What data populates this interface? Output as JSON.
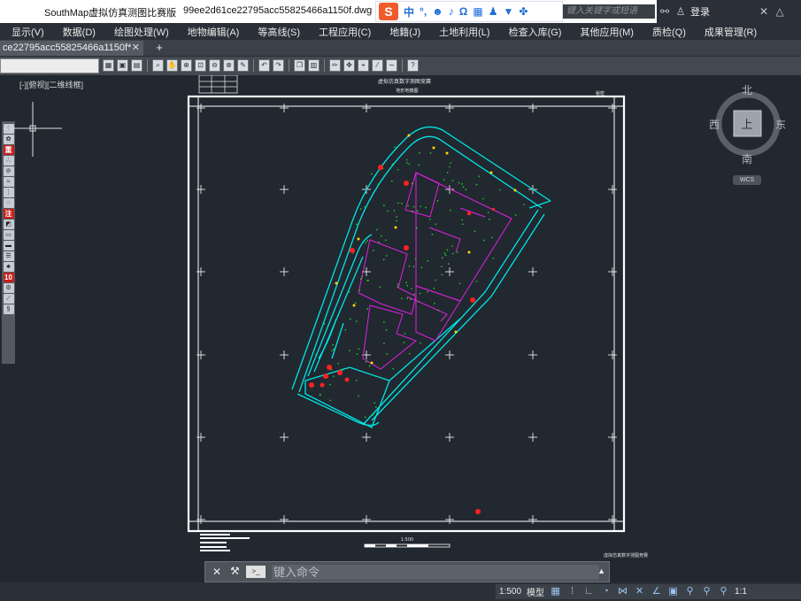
{
  "window": {
    "title": "SouthMap虚拟仿真测图比赛版",
    "filename": "99ee2d61ce22795acc55825466a1150f.dwg",
    "search_placeholder": "键入关键字或短语",
    "login_label": "登录"
  },
  "ime": {
    "mode": "中",
    "logo": "S"
  },
  "menu": [
    "显示(V)",
    "数据(D)",
    "绘图处理(W)",
    "地物编辑(A)",
    "等高线(S)",
    "工程应用(C)",
    "地籍(J)",
    "土地利用(L)",
    "检查入库(G)",
    "其他应用(M)",
    "质检(Q)",
    "成果管理(R)"
  ],
  "tabs": [
    {
      "label": "ce22795acc55825466a1150f*"
    }
  ],
  "viewport": {
    "label": "[-][俯视][二维线框]"
  },
  "left_tools": [
    "重",
    "注",
    "10"
  ],
  "drawing": {
    "top_title": "虚拟仿真数字测图竞赛",
    "top_subtitle": "地形地籍图",
    "corner_label": "秘密",
    "scale_label": "1:500",
    "bottom_label": "虚拟仿真数字测图竞赛"
  },
  "compass": {
    "north": "北",
    "south": "南",
    "east": "东",
    "west": "西",
    "center": "上",
    "wcs": "WCS"
  },
  "command": {
    "placeholder": "键入命令"
  },
  "status": {
    "scale": "1:500",
    "space": "模型",
    "annotation_scale": "1:1"
  },
  "colors": {
    "background": "#212830",
    "frame": "#ffffff",
    "road": "#00e5e5",
    "building": "#e020e0",
    "feature": "#ff2020",
    "vegetation": "#20e020"
  }
}
